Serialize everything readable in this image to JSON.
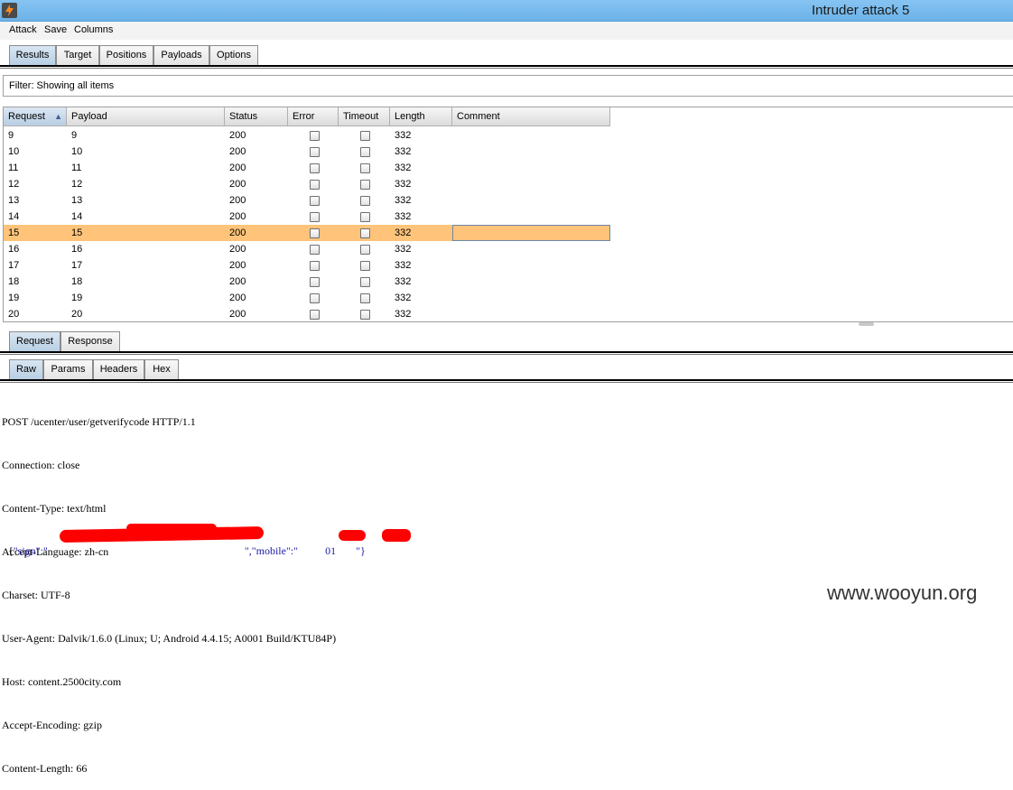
{
  "window": {
    "title": "Intruder attack 5"
  },
  "menu": [
    "Attack",
    "Save",
    "Columns"
  ],
  "main_tabs": [
    "Results",
    "Target",
    "Positions",
    "Payloads",
    "Options"
  ],
  "filter_text": "Filter: Showing all items",
  "table": {
    "columns": [
      "Request",
      "Payload",
      "Status",
      "Error",
      "Timeout",
      "Length",
      "Comment"
    ],
    "sort_column": "Request",
    "sort_direction": "ascending",
    "selected_request": "15",
    "rows": [
      {
        "request": "9",
        "payload": "9",
        "status": "200",
        "error": false,
        "timeout": false,
        "length": "332",
        "comment": ""
      },
      {
        "request": "10",
        "payload": "10",
        "status": "200",
        "error": false,
        "timeout": false,
        "length": "332",
        "comment": ""
      },
      {
        "request": "11",
        "payload": "11",
        "status": "200",
        "error": false,
        "timeout": false,
        "length": "332",
        "comment": ""
      },
      {
        "request": "12",
        "payload": "12",
        "status": "200",
        "error": false,
        "timeout": false,
        "length": "332",
        "comment": ""
      },
      {
        "request": "13",
        "payload": "13",
        "status": "200",
        "error": false,
        "timeout": false,
        "length": "332",
        "comment": ""
      },
      {
        "request": "14",
        "payload": "14",
        "status": "200",
        "error": false,
        "timeout": false,
        "length": "332",
        "comment": ""
      },
      {
        "request": "15",
        "payload": "15",
        "status": "200",
        "error": false,
        "timeout": false,
        "length": "332",
        "comment": ""
      },
      {
        "request": "16",
        "payload": "16",
        "status": "200",
        "error": false,
        "timeout": false,
        "length": "332",
        "comment": ""
      },
      {
        "request": "17",
        "payload": "17",
        "status": "200",
        "error": false,
        "timeout": false,
        "length": "332",
        "comment": ""
      },
      {
        "request": "18",
        "payload": "18",
        "status": "200",
        "error": false,
        "timeout": false,
        "length": "332",
        "comment": ""
      },
      {
        "request": "19",
        "payload": "19",
        "status": "200",
        "error": false,
        "timeout": false,
        "length": "332",
        "comment": ""
      },
      {
        "request": "20",
        "payload": "20",
        "status": "200",
        "error": false,
        "timeout": false,
        "length": "332",
        "comment": ""
      }
    ]
  },
  "detail_tabs": [
    "Request",
    "Response"
  ],
  "view_tabs": [
    "Raw",
    "Params",
    "Headers",
    "Hex"
  ],
  "raw_lines": [
    "POST /ucenter/user/getverifycode HTTP/1.1",
    "Connection: close",
    "Content-Type: text/html",
    "Accept-Language: zh-cn",
    "Charset: UTF-8",
    "User-Agent: Dalvik/1.6.0 (Linux; U; Android 4.4.15; A0001 Build/KTU84P)",
    "Host: content.2500city.com",
    "Accept-Encoding: gzip",
    "Content-Length: 66"
  ],
  "body": {
    "open": "{",
    "key_sign": "\"sign\"",
    "colon1": ":\"",
    "sep": "\",",
    "key_mobile": "\"mobile\"",
    "colon2": ":\"",
    "mobile_visible": "01",
    "close": "\"}"
  },
  "watermark": "www.wooyun.org",
  "colors": {
    "titlebar": "#6cb2e8",
    "selection": "#ffc47a",
    "redaction": "#ff0000"
  }
}
